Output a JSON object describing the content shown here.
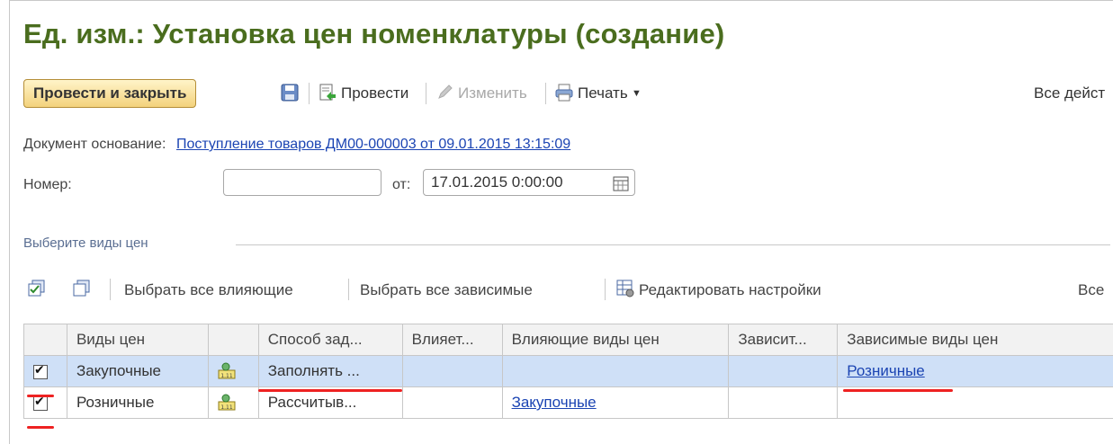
{
  "window": {
    "title": "Ед. изм.: Установка цен номенклатуры (создание)"
  },
  "toolbar": {
    "post_close": "Провести и закрыть",
    "post": "Провести",
    "edit": "Изменить",
    "print": "Печать",
    "all_actions": "Все дейст"
  },
  "form": {
    "base_doc_label": "Документ основание:",
    "base_doc_link": "Поступление товаров ДМ00-000003 от 09.01.2015 13:15:09",
    "number_label": "Номер:",
    "number_value": "",
    "date_label": "от:",
    "date_value": "17.01.2015  0:00:00"
  },
  "price_section": {
    "title": "Выберите виды цен",
    "select_influencing": "Выбрать все влияющие",
    "select_dependent": "Выбрать все зависимые",
    "edit_settings": "Редактировать настройки",
    "all": "Все"
  },
  "table": {
    "columns": [
      "",
      "Виды цен",
      "",
      "Способ зад...",
      "Влияет...",
      "Влияющие виды цен",
      "Зависит...",
      "Зависимые виды цен"
    ],
    "rows": [
      {
        "checked": true,
        "price_type": "Закупочные",
        "method": "Заполнять ...",
        "affects": "",
        "influencing": "",
        "depends": "",
        "dependent": "Розничные"
      },
      {
        "checked": true,
        "price_type": "Розничные",
        "method": "Рассчитыв...",
        "affects": "",
        "influencing": "Закупочные",
        "depends": "",
        "dependent": ""
      }
    ]
  },
  "colors": {
    "title_green": "#4a6d1e",
    "link_blue": "#1b44b3",
    "selection": "#cfe0f7",
    "annotation_red": "#e22222"
  }
}
